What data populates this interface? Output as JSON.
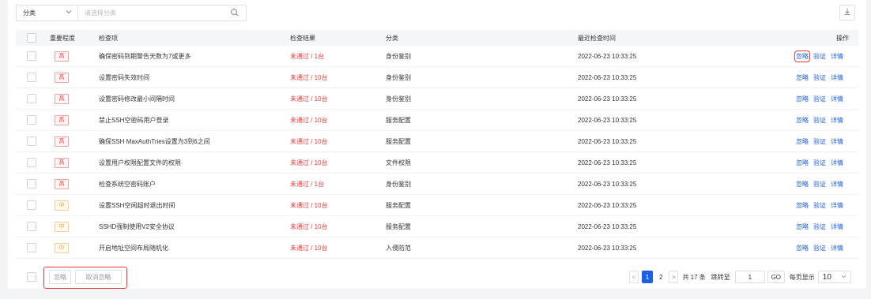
{
  "filter": {
    "category_label": "分类",
    "placeholder": "请选择分类"
  },
  "table": {
    "headers": {
      "importance": "重要程度",
      "item": "检查项",
      "result": "检查结果",
      "category": "分类",
      "time": "最近检查时间",
      "ops": "操作"
    },
    "rows": [
      {
        "level": "高",
        "item": "确保密码到期警告天数为7或更多",
        "result": "未通过 / 1台",
        "category": "身份鉴别",
        "time": "2022-06-23 10:33:25"
      },
      {
        "level": "高",
        "item": "设置密码失效时间",
        "result": "未通过 / 10台",
        "category": "身份鉴别",
        "time": "2022-06-23 10:33:25"
      },
      {
        "level": "高",
        "item": "设置密码修改最小间隔时间",
        "result": "未通过 / 10台",
        "category": "身份鉴别",
        "time": "2022-06-23 10:33:25"
      },
      {
        "level": "高",
        "item": "禁止SSH空密码用户登录",
        "result": "未通过 / 10台",
        "category": "服务配置",
        "time": "2022-06-23 10:33:25"
      },
      {
        "level": "高",
        "item": "确保SSH MaxAuthTries设置为3到6之间",
        "result": "未通过 / 10台",
        "category": "服务配置",
        "time": "2022-06-23 10:33:25"
      },
      {
        "level": "高",
        "item": "设置用户权限配置文件的权限",
        "result": "未通过 / 10台",
        "category": "文件权限",
        "time": "2022-06-23 10:33:25"
      },
      {
        "level": "高",
        "item": "检查系统空密码账户",
        "result": "未通过 / 1台",
        "category": "身份鉴别",
        "time": "2022-06-23 10:33:25"
      },
      {
        "level": "中",
        "item": "设置SSH空闲超时退出时间",
        "result": "未通过 / 10台",
        "category": "服务配置",
        "time": "2022-06-23 10:33:25"
      },
      {
        "level": "中",
        "item": "SSHD强制使用V2安全协议",
        "result": "未通过 / 10台",
        "category": "服务配置",
        "time": "2022-06-23 10:33:25"
      },
      {
        "level": "中",
        "item": "开启地址空间布局随机化",
        "result": "未通过 / 10台",
        "category": "入侵防范",
        "time": "2022-06-23 10:33:25"
      }
    ],
    "actions": {
      "ignore": "忽略",
      "verify": "验证",
      "detail": "详情"
    }
  },
  "footer": {
    "ignore_btn": "忽略",
    "unignore_btn": "取消忽略",
    "pager": {
      "prev": "<",
      "page1": "1",
      "page2": "2",
      "next": ">",
      "total": "共 17 条",
      "jump_label": "跳转至",
      "jump_value": "1",
      "go": "GO",
      "per_page_label": "每页显示",
      "per_page_value": "10"
    }
  },
  "colors": {
    "accent": "#1a5fe6",
    "danger": "#e4393c",
    "warning": "#f0a030"
  }
}
